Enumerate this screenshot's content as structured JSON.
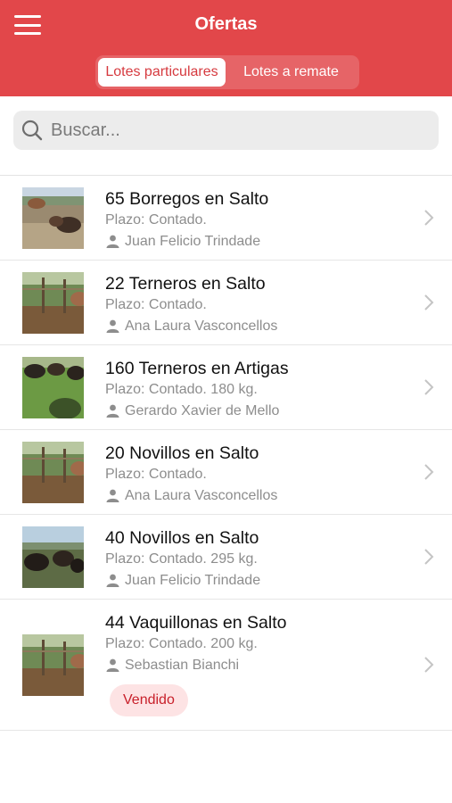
{
  "header": {
    "title": "Ofertas",
    "tabs": [
      {
        "label": "Lotes particulares",
        "active": true
      },
      {
        "label": "Lotes a remate",
        "active": false
      }
    ]
  },
  "search": {
    "placeholder": "Buscar..."
  },
  "colors": {
    "brand": "#e2474a",
    "sold_badge_bg": "#fde3e4",
    "sold_badge_text": "#c8202a"
  },
  "lots": [
    {
      "title": "65 Borregos en Salto",
      "terms": "Plazo: Contado.",
      "seller": "Juan Felicio Trindade"
    },
    {
      "title": "22 Terneros en Salto",
      "terms": "Plazo: Contado.",
      "seller": "Ana Laura Vasconcellos"
    },
    {
      "title": "160 Terneros en Artigas",
      "terms": "Plazo: Contado. 180 kg.",
      "seller": "Gerardo Xavier de Mello"
    },
    {
      "title": "20 Novillos en Salto",
      "terms": "Plazo: Contado.",
      "seller": "Ana Laura Vasconcellos"
    },
    {
      "title": "40 Novillos en Salto",
      "terms": "Plazo: Contado. 295 kg.",
      "seller": "Juan Felicio Trindade"
    },
    {
      "title": "44 Vaquillonas en Salto",
      "terms": "Plazo: Contado. 200 kg.",
      "seller": "Sebastian Bianchi",
      "badge": "Vendido"
    }
  ]
}
